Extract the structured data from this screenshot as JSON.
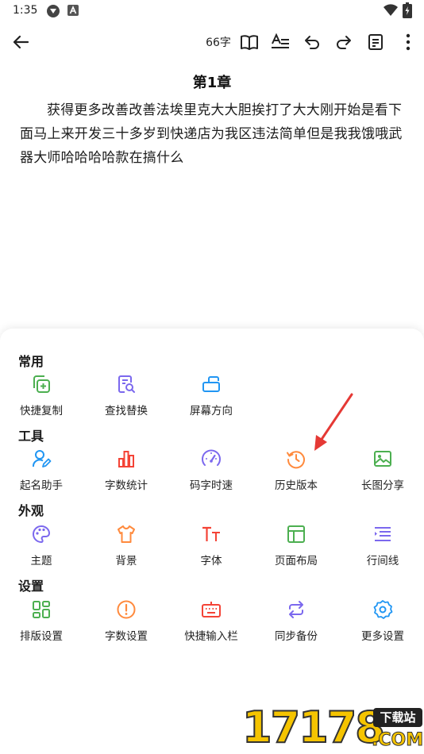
{
  "status_bar": {
    "time": "1:35"
  },
  "toolbar": {
    "word_count": "66字"
  },
  "chapter": {
    "title": "第1章",
    "body": "获得更多改善改善法埃里克大大胆挨打了大大刚开始是看下面马上来开发三十多岁到快递店为我区违法简单但是我我饿哦武器大师哈哈哈哈款在搞什么"
  },
  "menu": {
    "sections": [
      {
        "title": "常用",
        "items": [
          {
            "label": "快捷复制",
            "icon": "copy-add-icon",
            "color": "#4caf50"
          },
          {
            "label": "查找替换",
            "icon": "find-replace-icon",
            "color": "#7b68ee"
          },
          {
            "label": "屏幕方向",
            "icon": "screen-rotation-icon",
            "color": "#2196f3"
          }
        ]
      },
      {
        "title": "工具",
        "items": [
          {
            "label": "起名助手",
            "icon": "name-assistant-icon",
            "color": "#2196f3"
          },
          {
            "label": "字数统计",
            "icon": "word-stats-icon",
            "color": "#f44336"
          },
          {
            "label": "码字时速",
            "icon": "typing-speed-icon",
            "color": "#7b68ee"
          },
          {
            "label": "历史版本",
            "icon": "history-icon",
            "color": "#ff8a3d"
          },
          {
            "label": "长图分享",
            "icon": "image-share-icon",
            "color": "#4caf50"
          }
        ]
      },
      {
        "title": "外观",
        "items": [
          {
            "label": "主题",
            "icon": "palette-icon",
            "color": "#7b68ee"
          },
          {
            "label": "背景",
            "icon": "tshirt-icon",
            "color": "#ff8a3d"
          },
          {
            "label": "字体",
            "icon": "font-icon",
            "color": "#f44336"
          },
          {
            "label": "页面布局",
            "icon": "page-layout-icon",
            "color": "#4caf50"
          },
          {
            "label": "行间线",
            "icon": "line-spacing-icon",
            "color": "#7b68ee"
          }
        ]
      },
      {
        "title": "设置",
        "items": [
          {
            "label": "排版设置",
            "icon": "layout-grid-icon",
            "color": "#4caf50"
          },
          {
            "label": "字数设置",
            "icon": "alert-circle-icon",
            "color": "#ff8a3d"
          },
          {
            "label": "快捷输入栏",
            "icon": "keyboard-icon",
            "color": "#f44336"
          },
          {
            "label": "同步备份",
            "icon": "sync-icon",
            "color": "#7b68ee"
          },
          {
            "label": "更多设置",
            "icon": "gear-icon",
            "color": "#2196f3"
          }
        ]
      }
    ]
  },
  "watermark": {
    "text": "17178",
    "badge": "下载站",
    "domain": ".COM"
  }
}
